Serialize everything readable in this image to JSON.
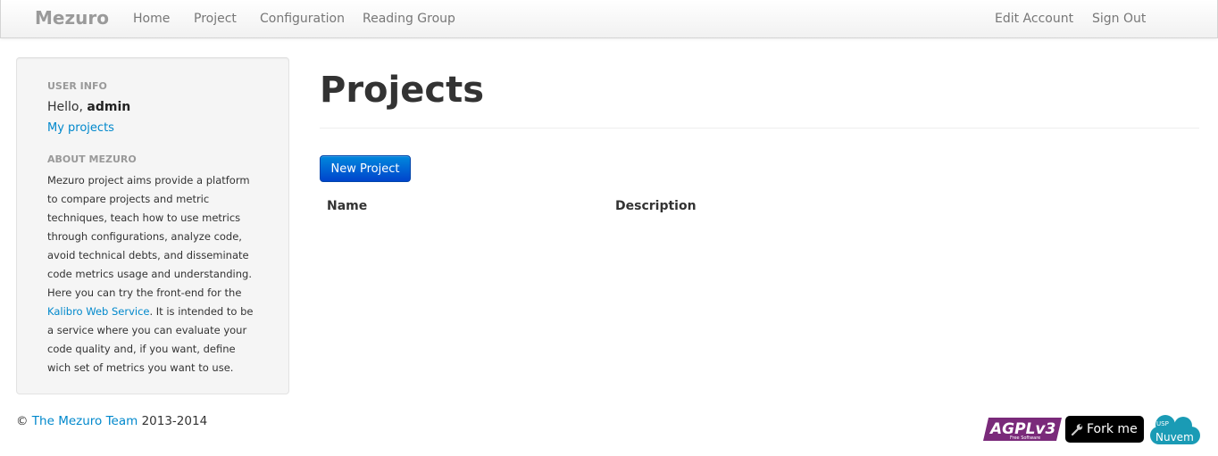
{
  "navbar": {
    "brand": "Mezuro",
    "links": [
      "Home",
      "Project",
      "Configuration",
      "Reading Group"
    ],
    "right_links": [
      "Edit Account",
      "Sign Out"
    ]
  },
  "sidebar": {
    "user_info_header": "USER INFO",
    "hello_prefix": "Hello, ",
    "username": "admin",
    "my_projects": "My projects",
    "about_header": "ABOUT MEZURO",
    "about_text_1": "Mezuro project aims provide a platform to compare projects and metric techniques, teach how to use metrics through configurations, analyze code, avoid technical debts, and disseminate code metrics usage and understanding.",
    "about_text_2": "Here you can try the front-end for the ",
    "kalibro_link": "Kalibro Web Service",
    "about_text_3": ". It is intended to be a service where you can evaluate your code quality and, if you want, define wich set of metrics you want to use."
  },
  "main": {
    "title": "Projects",
    "new_project_button": "New Project",
    "table_headers": [
      "Name",
      "Description"
    ]
  },
  "footer": {
    "copyright_symbol": "©",
    "team_link": "The Mezuro Team",
    "years": "2013-2014",
    "agpl_label": "AGPLv3",
    "agpl_sub": "Free Software",
    "fork_label": "Fork me",
    "nuvem_label": "Nuvem",
    "nuvem_badge": "USP"
  },
  "colors": {
    "link": "#0088cc",
    "button_primary": "#0055cc",
    "agpl_purple": "#7a2a7a",
    "nuvem_teal": "#1a9bb5"
  }
}
